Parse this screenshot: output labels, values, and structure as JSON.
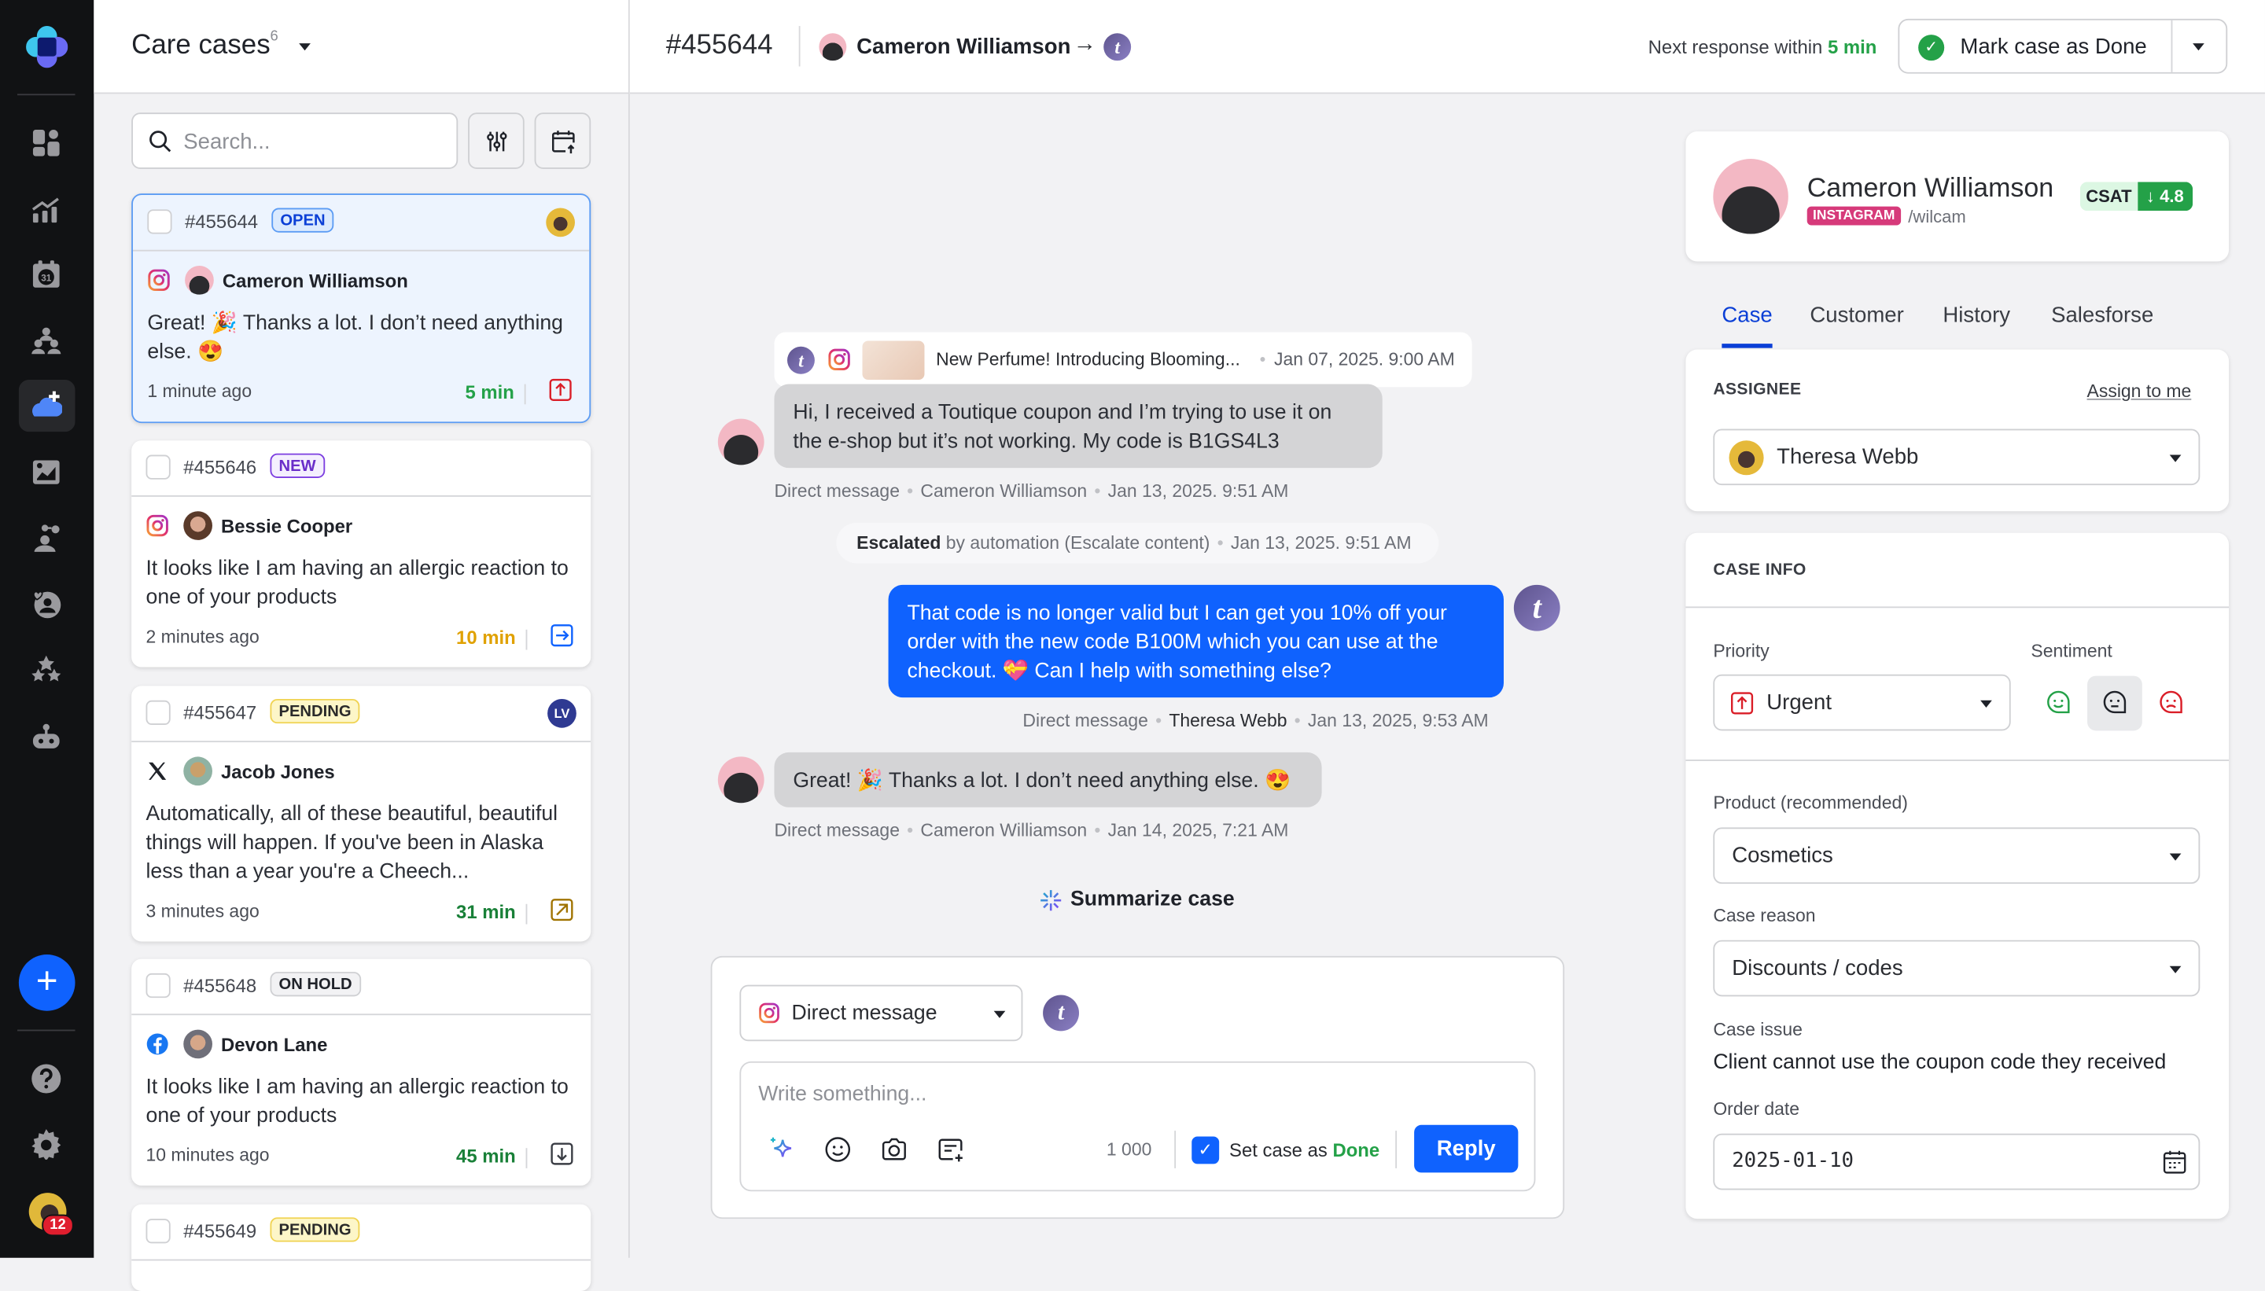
{
  "sidebar": {
    "items": [
      {
        "icon": "dashboard-icon"
      },
      {
        "icon": "analytics-icon"
      },
      {
        "icon": "calendar-icon",
        "badge": "31"
      },
      {
        "icon": "teams-icon"
      },
      {
        "icon": "care-cases-icon",
        "active": true
      },
      {
        "icon": "media-library-icon"
      },
      {
        "icon": "network-icon"
      },
      {
        "icon": "community-icon"
      },
      {
        "icon": "reviews-icon"
      },
      {
        "icon": "bot-icon"
      }
    ],
    "add_label": "+",
    "help_icon": "help-icon",
    "settings_icon": "settings-icon",
    "notifications_count": "12"
  },
  "case_list": {
    "title": "Care cases",
    "count": "6",
    "search_placeholder": "Search...",
    "cases": [
      {
        "id": "#455644",
        "status": "OPEN",
        "channel": "instagram",
        "customer": "Cameron Williamson",
        "message": "Great! 🎉 Thanks a lot. I don’t need anything else. 😍",
        "time_ago": "1 minute ago",
        "sla": "5 min",
        "sla_color": "#24a148",
        "priority": "urgent",
        "priority_color": "#da1e28",
        "assignee": "Theresa Webb"
      },
      {
        "id": "#455646",
        "status": "NEW",
        "channel": "instagram",
        "customer": "Bessie Cooper",
        "message": "It looks like I am having an allergic reaction to one of your products",
        "time_ago": "2 minutes ago",
        "sla": "10 min",
        "sla_color": "#e0a100",
        "priority": "normal",
        "priority_color": "#0f62fe"
      },
      {
        "id": "#455647",
        "status": "PENDING",
        "channel": "x",
        "customer": "Jacob Jones",
        "message": "Automatically, all of these beautiful, beautiful things will happen. If you've been in Alaska less than a year you're a Cheech...",
        "time_ago": "3 minutes ago",
        "sla": "31 min",
        "sla_color": "#198038",
        "priority": "high",
        "priority_color": "#a07300",
        "assignee": "LV"
      },
      {
        "id": "#455648",
        "status": "ON HOLD",
        "channel": "facebook",
        "customer": "Devon Lane",
        "message": "It looks like I am having an allergic reaction to one of your products",
        "time_ago": "10 minutes ago",
        "sla": "45 min",
        "sla_color": "#198038",
        "priority": "low",
        "priority_color": "#3a3d44"
      },
      {
        "id": "#455649",
        "status": "PENDING"
      }
    ]
  },
  "header": {
    "case_number": "#455644",
    "customer": "Cameron Williamson",
    "arrow": "→",
    "brand_initial": "t",
    "next_response_label": "Next response within",
    "next_response_value": "5 min",
    "mark_done_label": "Mark case as Done"
  },
  "conversation": {
    "post": {
      "title": "New Perfume! Introducing Blooming...",
      "date": "Jan 07, 2025. 9:00 AM"
    },
    "messages": [
      {
        "direction": "in",
        "text": "Hi, I received a Toutique coupon and I’m trying to use it on the e-shop but it’s not working. My code is B1GS4L3",
        "channel": "Direct message",
        "author": "Cameron Williamson",
        "date": "Jan 13, 2025. 9:51 AM"
      },
      {
        "direction": "out",
        "text": "That code is no longer valid but I can get you 10% off your order with the new code B100M which you can use at the checkout. 💝 Can I help with something else?",
        "channel": "Direct message",
        "author": "Theresa Webb",
        "date": "Jan 13, 2025, 9:53 AM"
      },
      {
        "direction": "in",
        "text": "Great! 🎉 Thanks a lot. I don’t need anything else. 😍",
        "channel": "Direct message",
        "author": "Cameron Williamson",
        "date": "Jan 14, 2025, 7:21 AM"
      }
    ],
    "escalation": {
      "bold": "Escalated",
      "text": "by automation (Escalate content)",
      "date": "Jan 13, 2025. 9:51 AM"
    },
    "summarize_label": "Summarize case"
  },
  "composer": {
    "channel": "Direct message",
    "placeholder": "Write something...",
    "char_count": "1 000",
    "set_done_label": "Set case as",
    "set_done_value": "Done",
    "set_done_checked": true,
    "reply_label": "Reply"
  },
  "profile": {
    "name": "Cameron Williamson",
    "network": "INSTAGRAM",
    "handle": "/wilcam",
    "csat_label": "CSAT",
    "csat_trend": "↓",
    "csat_value": "4.8"
  },
  "details_tabs": [
    {
      "label": "Case",
      "active": true
    },
    {
      "label": "Customer"
    },
    {
      "label": "History"
    },
    {
      "label": "Salesforse"
    }
  ],
  "assignee": {
    "title": "ASSIGNEE",
    "assign_to_me": "Assign to me",
    "value": "Theresa Webb"
  },
  "case_info": {
    "title": "CASE INFO",
    "priority_label": "Priority",
    "priority_value": "Urgent",
    "sentiment_label": "Sentiment",
    "sentiment_options": [
      "positive",
      "neutral",
      "negative"
    ],
    "sentiment_selected": "neutral",
    "product_label": "Product (recommended)",
    "product_value": "Cosmetics",
    "reason_label": "Case reason",
    "reason_value": "Discounts / codes",
    "issue_label": "Case issue",
    "issue_value": "Client cannot use the coupon code they received",
    "order_date_label": "Order date",
    "order_date_value": "2025-01-10"
  },
  "colors": {
    "accent": "#0f62fe",
    "success": "#24a148",
    "danger": "#da1e28",
    "rail": "#111214"
  }
}
